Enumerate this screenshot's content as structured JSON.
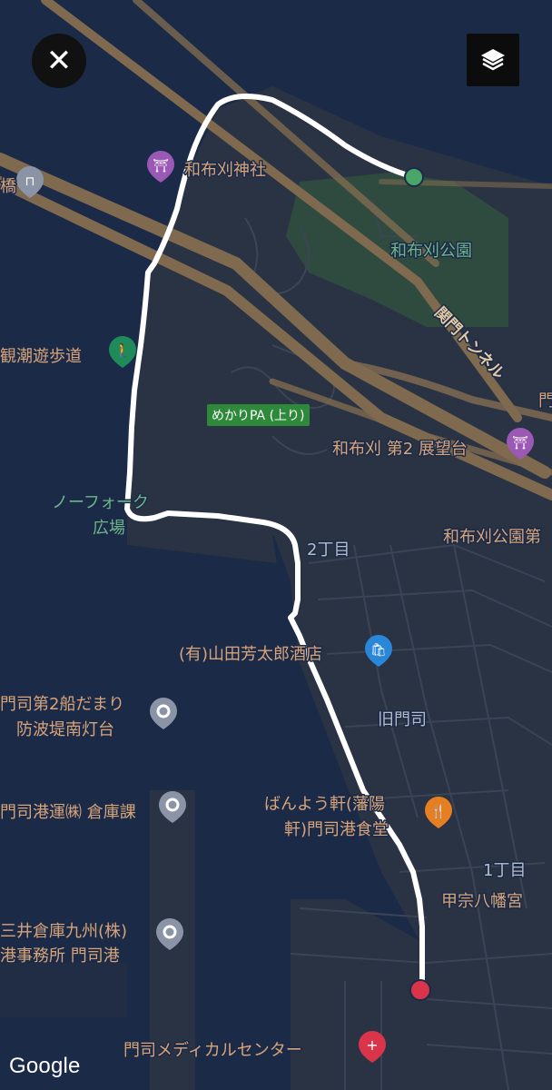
{
  "controls": {
    "close_glyph": "✕",
    "layers_icon": "layers-icon"
  },
  "attribution": "Google",
  "colors": {
    "water": "#1b2a47",
    "land": "#2a3343",
    "park": "#2f4a3f",
    "road": "#7f6a50",
    "route": "#ffffff",
    "start_marker": "#4aa56a",
    "end_marker": "#d9344a"
  },
  "places": {
    "mekari_shrine": "和布刈神社",
    "mekari_park": "和布刈公園",
    "kanmon_tunnel": "関門トンネル",
    "kanchou_walk": "観潮遊歩道",
    "mekari_pa": "めかりPA (上り)",
    "observatory": "和布刈 第2 展望台",
    "norfolk_1": "ノーフォーク",
    "norfolk_2": "広場",
    "mekari_park_2": "和布刈公園第",
    "chome2": "2丁目",
    "yamada_liquor": "(有)山田芳太郎酒店",
    "old_moji": "旧門司",
    "lighthouse_1": "門司第2船だまり",
    "lighthouse_2": "防波堤南灯台",
    "warehouse": "門司港運㈱ 倉庫課",
    "banyoken_1": "ばんよう軒(藩陽",
    "banyoken_2": "軒)門司港食堂",
    "chome1": "1丁目",
    "kofune_shrine": "甲宗八幡宮",
    "mitsui_1": "三井倉庫九州(株)",
    "mitsui_2": "港事務所 門司港",
    "medical_center": "門司メディカルセンター",
    "left_edge_char": "橋",
    "right_edge_char": "門"
  }
}
